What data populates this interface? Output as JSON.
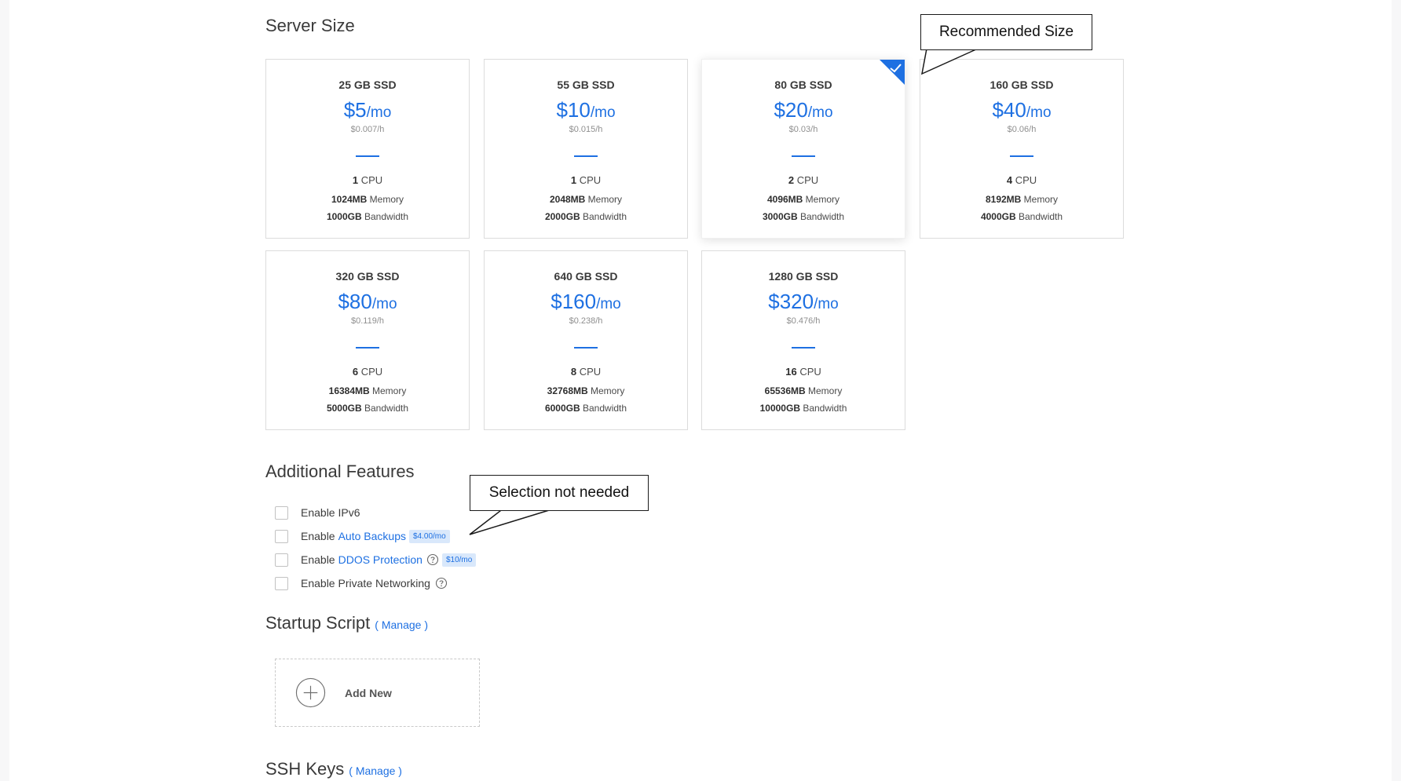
{
  "sections": {
    "server_size": "Server Size",
    "additional_features": "Additional Features",
    "startup_script": "Startup Script",
    "ssh_keys": "SSH Keys",
    "manage_label": "( Manage )"
  },
  "plans": [
    {
      "storage": "25 GB SSD",
      "price": "$5",
      "per": "/mo",
      "hourly": "$0.007/h",
      "cpu": "1",
      "cpu_label": "CPU",
      "memory": "1024MB",
      "memory_label": "Memory",
      "bandwidth": "1000GB",
      "bandwidth_label": "Bandwidth",
      "selected": false
    },
    {
      "storage": "55 GB SSD",
      "price": "$10",
      "per": "/mo",
      "hourly": "$0.015/h",
      "cpu": "1",
      "cpu_label": "CPU",
      "memory": "2048MB",
      "memory_label": "Memory",
      "bandwidth": "2000GB",
      "bandwidth_label": "Bandwidth",
      "selected": false
    },
    {
      "storage": "80 GB SSD",
      "price": "$20",
      "per": "/mo",
      "hourly": "$0.03/h",
      "cpu": "2",
      "cpu_label": "CPU",
      "memory": "4096MB",
      "memory_label": "Memory",
      "bandwidth": "3000GB",
      "bandwidth_label": "Bandwidth",
      "selected": true
    },
    {
      "storage": "160 GB SSD",
      "price": "$40",
      "per": "/mo",
      "hourly": "$0.06/h",
      "cpu": "4",
      "cpu_label": "CPU",
      "memory": "8192MB",
      "memory_label": "Memory",
      "bandwidth": "4000GB",
      "bandwidth_label": "Bandwidth",
      "selected": false
    },
    {
      "storage": "320 GB SSD",
      "price": "$80",
      "per": "/mo",
      "hourly": "$0.119/h",
      "cpu": "6",
      "cpu_label": "CPU",
      "memory": "16384MB",
      "memory_label": "Memory",
      "bandwidth": "5000GB",
      "bandwidth_label": "Bandwidth",
      "selected": false
    },
    {
      "storage": "640 GB SSD",
      "price": "$160",
      "per": "/mo",
      "hourly": "$0.238/h",
      "cpu": "8",
      "cpu_label": "CPU",
      "memory": "32768MB",
      "memory_label": "Memory",
      "bandwidth": "6000GB",
      "bandwidth_label": "Bandwidth",
      "selected": false
    },
    {
      "storage": "1280 GB SSD",
      "price": "$320",
      "per": "/mo",
      "hourly": "$0.476/h",
      "cpu": "16",
      "cpu_label": "CPU",
      "memory": "65536MB",
      "memory_label": "Memory",
      "bandwidth": "10000GB",
      "bandwidth_label": "Bandwidth",
      "selected": false
    }
  ],
  "callouts": {
    "recommended": "Recommended Size",
    "not_needed": "Selection not needed"
  },
  "features": {
    "ipv6": {
      "text": "Enable IPv6",
      "checked": false
    },
    "backups": {
      "prefix": "Enable",
      "link": "Auto Backups",
      "badge": "$4.00/mo",
      "checked": false
    },
    "ddos": {
      "prefix": "Enable",
      "link": "DDOS Protection",
      "badge": "$10/mo",
      "checked": false
    },
    "private_net": {
      "text": "Enable Private Networking",
      "checked": false
    }
  },
  "startup": {
    "add_new": "Add New"
  },
  "colors": {
    "accent": "#1e70e2",
    "badge_bg": "#d9e8fb"
  },
  "icons": {
    "selected_marker": "check-icon",
    "help": "question-circle-icon",
    "add": "plus-circle-icon"
  }
}
